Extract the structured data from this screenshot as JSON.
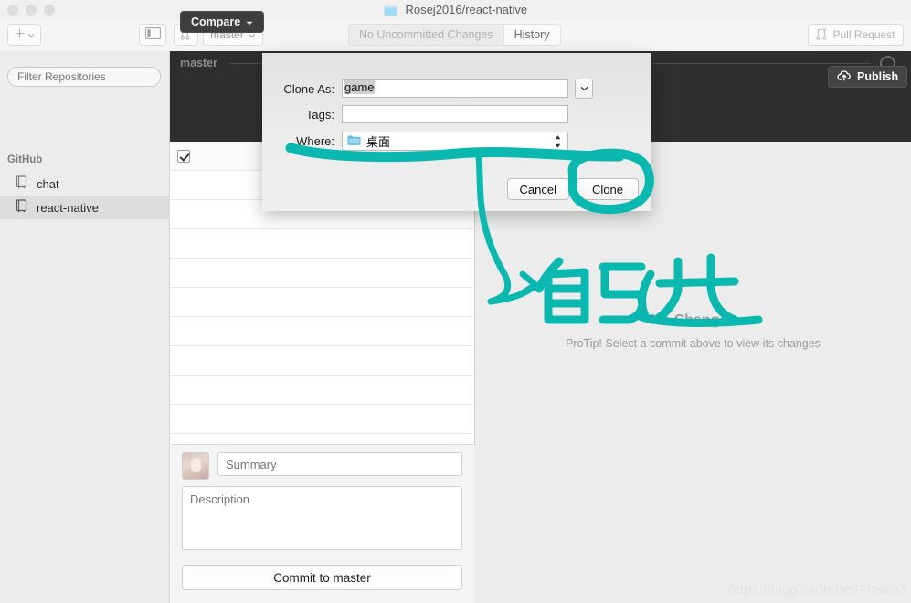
{
  "window": {
    "title": "Rosej2016/react-native",
    "title_icon": "folder-icon",
    "traffic_lights": [
      "close-button",
      "minimize-button",
      "zoom-button"
    ]
  },
  "toolbar": {
    "add_label": "+",
    "add_chevron": "⌄",
    "sidebar_toggle_icon": "sidebar-panel-icon",
    "new_branch_icon": "branch-plus-icon",
    "branch_button_label": "master",
    "branch_button_chevron": "⌄",
    "segments": [
      {
        "label": "No Uncommitted Changes",
        "active": false
      },
      {
        "label": "History",
        "active": true
      }
    ],
    "pull_request_label": "Pull Request",
    "pull_request_icon": "pull-request-icon"
  },
  "sidebar": {
    "filter_placeholder": "Filter Repositories",
    "filter_value": "",
    "group_label": "GitHub",
    "repos": [
      {
        "name": "chat",
        "icon": "repository-icon",
        "selected": false
      },
      {
        "name": "react-native",
        "icon": "repository-icon",
        "selected": true
      }
    ]
  },
  "history_header": {
    "compare_label": "Compare",
    "compare_chevron": "▾",
    "branch_label": "master",
    "publish_label": "Publish",
    "publish_icon": "cloud-upload-icon",
    "commit_node_icon": "commit-circle-icon"
  },
  "file_list": {
    "rows": [
      {
        "checked": true
      },
      {
        "checked": false
      },
      {
        "checked": false
      },
      {
        "checked": false
      },
      {
        "checked": false
      },
      {
        "checked": false
      },
      {
        "checked": false
      },
      {
        "checked": false
      },
      {
        "checked": false
      },
      {
        "checked": false
      }
    ]
  },
  "composer": {
    "avatar": "user-avatar",
    "summary_placeholder": "Summary",
    "summary_value": "",
    "description_placeholder": "Description",
    "description_value": "",
    "commit_button_label": "Commit to master"
  },
  "right_pane": {
    "empty_title": "No Changes",
    "empty_hint": "ProTip! Select a commit above to view its changes"
  },
  "clone_dialog": {
    "clone_as_label": "Clone As:",
    "clone_as_value": "game",
    "clone_as_popup_icon": "chevron-down-icon",
    "tags_label": "Tags:",
    "tags_value": "",
    "where_label": "Where:",
    "where_value": "桌面",
    "where_icon": "folder-icon",
    "where_stepper_icon": "stepper-updown-icon",
    "cancel_label": "Cancel",
    "clone_label": "Clone"
  },
  "annotation": {
    "ink_color": "#0bb8b0",
    "handwritten_text": "自己选",
    "shapes": [
      "underline-where-field",
      "arrow-to-text",
      "circle-around-clone-button"
    ]
  },
  "watermark": {
    "text": "https://blog.csdn.net/Theo93"
  },
  "colors": {
    "dark_header": "#2e2e2e",
    "window_chrome": "#f0f0f0",
    "sidebar_bg": "#ececec",
    "selection": "#dcdcdc",
    "ink": "#0bb8b0"
  }
}
